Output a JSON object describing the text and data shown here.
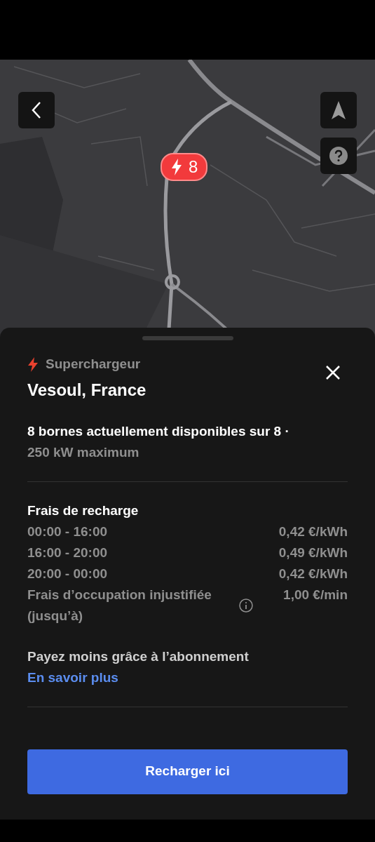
{
  "map": {
    "kind": "picture",
    "marker": {
      "count": "8"
    },
    "buttons": [
      {
        "kind": "back"
      },
      {
        "kind": "navigate"
      },
      {
        "kind": "help"
      }
    ]
  },
  "sheet": {
    "category": "Superchargeur",
    "title": "Vesoul, France",
    "availability": "8 bornes actuellement disponibles sur 8 ·",
    "power": "250 kW maximum",
    "fees": {
      "heading": "Frais de recharge",
      "rows": [
        {
          "label": "00:00 - 16:00",
          "price": "0,42 €/kWh",
          "info": false
        },
        {
          "label": "16:00 - 20:00",
          "price": "0,49 €/kWh",
          "info": false
        },
        {
          "label": "20:00 - 00:00",
          "price": "0,42 €/kWh",
          "info": false
        },
        {
          "label": "Frais d’occupation injustifiée (jusqu’à)",
          "price": "1,00 €/min",
          "info": true
        }
      ]
    },
    "subscription": {
      "text": "Payez moins grâce à l’abonnement",
      "link": "En savoir plus"
    },
    "action": "Recharger ici"
  }
}
